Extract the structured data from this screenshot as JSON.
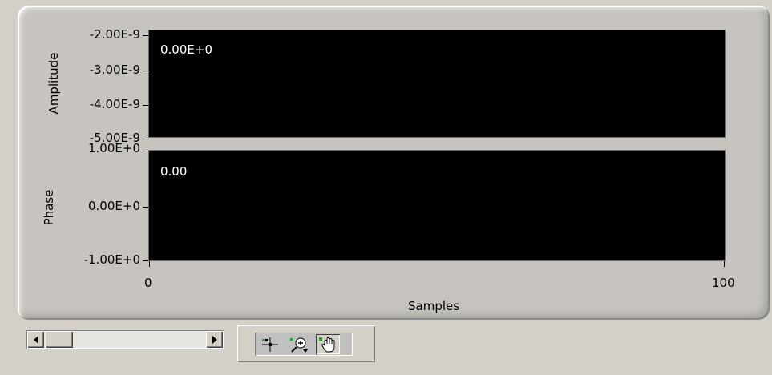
{
  "graph": {
    "amplitude": {
      "axis_title": "Amplitude",
      "ticks": [
        "-2.00E-9",
        "-3.00E-9",
        "-4.00E-9",
        "-5.00E-9"
      ],
      "readout": "0.00E+0"
    },
    "phase": {
      "axis_title": "Phase",
      "ticks": [
        "1.00E+0",
        "0.00E+0",
        "-1.00E+0"
      ],
      "readout": "0.00"
    },
    "x_axis": {
      "title": "Samples",
      "ticks": [
        "0",
        "100"
      ]
    }
  },
  "palette": {
    "tools": [
      {
        "name": "cursor-move-icon"
      },
      {
        "name": "zoom-icon"
      },
      {
        "name": "pan-hand-icon"
      }
    ]
  },
  "scrollbar": {
    "icons": [
      "scroll-left-arrow-icon",
      "scroll-right-arrow-icon"
    ]
  }
}
